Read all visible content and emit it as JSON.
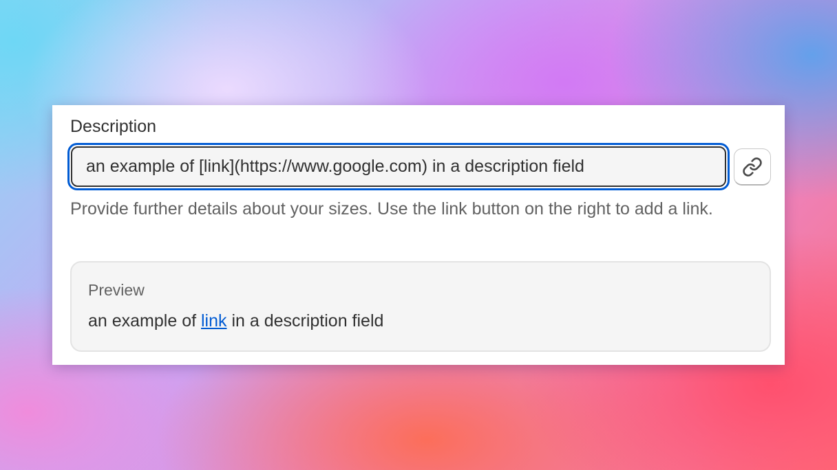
{
  "field": {
    "label": "Description",
    "value": "an example of [link](https://www.google.com) in a description field",
    "help_text": "Provide further details about your sizes. Use the link button on the right to add a link.",
    "link_button_icon": "link-icon"
  },
  "preview": {
    "title": "Preview",
    "text_before": "an example of ",
    "link_text": "link",
    "text_after": " in a description field"
  },
  "colors": {
    "focus_ring": "#005bd3",
    "link": "#005bd3",
    "text": "#303030",
    "muted_text": "#616161"
  }
}
